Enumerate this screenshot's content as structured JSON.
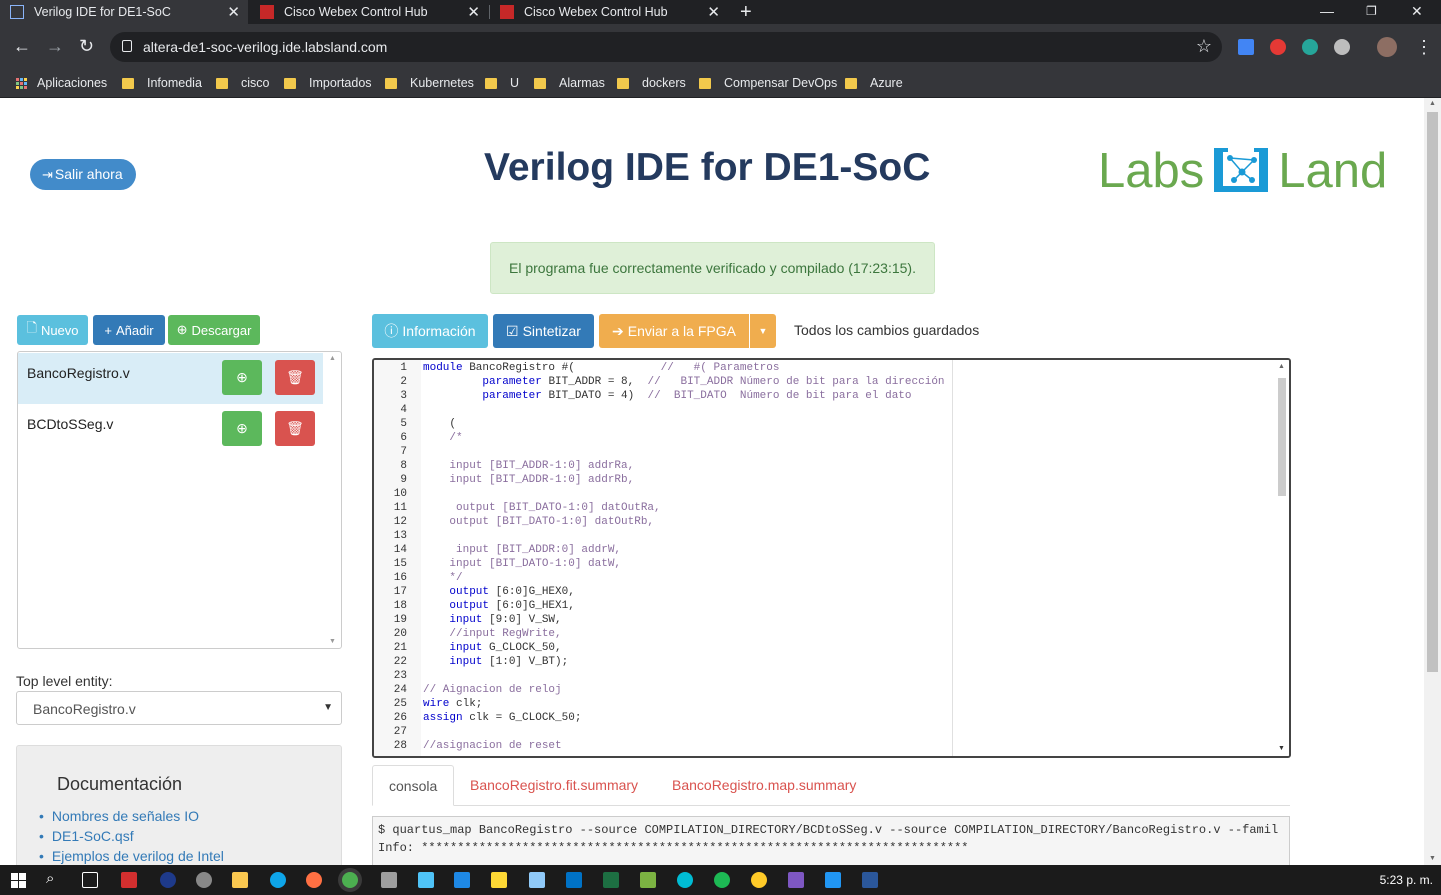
{
  "browser": {
    "tabs": [
      {
        "title": "Verilog IDE for DE1-SoC",
        "active": true
      },
      {
        "title": "Cisco Webex Control Hub",
        "active": false
      },
      {
        "title": "Cisco Webex Control Hub",
        "active": false
      }
    ],
    "url": "altera-de1-soc-verilog.ide.labsland.com",
    "bookmarks": [
      "Aplicaciones",
      "Infomedia",
      "cisco",
      "Importados",
      "Kubernetes",
      "U",
      "Alarmas",
      "dockers",
      "Compensar DevOps",
      "Azure"
    ]
  },
  "header": {
    "exit_label": "Salir ahora",
    "title": "Verilog IDE for DE1-SoC",
    "logo_left": "Labs",
    "logo_right": "Land"
  },
  "alert": "El programa fue correctamente verificado y compilado (17:23:15).",
  "file_toolbar": {
    "new": "Nuevo",
    "add": "Añadir",
    "download": "Descargar"
  },
  "files": [
    {
      "name": "BancoRegistro.v",
      "selected": true
    },
    {
      "name": "BCDtoSSeg.v",
      "selected": false
    }
  ],
  "top_level": {
    "label": "Top level entity:",
    "value": "BancoRegistro.v"
  },
  "docs": {
    "title": "Documentación",
    "links": [
      "Nombres de señales IO",
      "DE1-SoC.qsf",
      "Ejemplos de verilog de Intel"
    ]
  },
  "editor_toolbar": {
    "info": "Información",
    "synth": "Sintetizar",
    "send": "Enviar a la FPGA",
    "status": "Todos los cambios guardados"
  },
  "code": [
    [
      {
        "t": "module",
        "c": "kw"
      },
      {
        "t": " BancoRegistro #(             ",
        "c": ""
      },
      {
        "t": "//   #( Parametros",
        "c": "cm"
      }
    ],
    [
      {
        "t": "         ",
        "c": ""
      },
      {
        "t": "parameter",
        "c": "kw"
      },
      {
        "t": " BIT_ADDR = 8,  ",
        "c": ""
      },
      {
        "t": "//   BIT_ADDR Número de bit para la dirección",
        "c": "cm"
      }
    ],
    [
      {
        "t": "         ",
        "c": ""
      },
      {
        "t": "parameter",
        "c": "kw"
      },
      {
        "t": " BIT_DATO = 4)  ",
        "c": ""
      },
      {
        "t": "//  BIT_DATO  Número de bit para el dato",
        "c": "cm"
      }
    ],
    [],
    [
      {
        "t": "    (",
        "c": ""
      }
    ],
    [
      {
        "t": "    /*",
        "c": "cm"
      }
    ],
    [],
    [
      {
        "t": "    input [BIT_ADDR-1:0] addrRa,",
        "c": "cm"
      }
    ],
    [
      {
        "t": "    input [BIT_ADDR-1:0] addrRb,",
        "c": "cm"
      }
    ],
    [],
    [
      {
        "t": "     output [BIT_DATO-1:0] datOutRa,",
        "c": "cm"
      }
    ],
    [
      {
        "t": "    output [BIT_DATO-1:0] datOutRb,",
        "c": "cm"
      }
    ],
    [],
    [
      {
        "t": "     input [BIT_ADDR:0] addrW,",
        "c": "cm"
      }
    ],
    [
      {
        "t": "    input [BIT_DATO-1:0] datW,",
        "c": "cm"
      }
    ],
    [
      {
        "t": "    */",
        "c": "cm"
      }
    ],
    [
      {
        "t": "    ",
        "c": ""
      },
      {
        "t": "output",
        "c": "kw"
      },
      {
        "t": " [6:0]G_HEX0,",
        "c": ""
      }
    ],
    [
      {
        "t": "    ",
        "c": ""
      },
      {
        "t": "output",
        "c": "kw"
      },
      {
        "t": " [6:0]G_HEX1,",
        "c": ""
      }
    ],
    [
      {
        "t": "    ",
        "c": ""
      },
      {
        "t": "input",
        "c": "kw"
      },
      {
        "t": " [9:0] V_SW,",
        "c": ""
      }
    ],
    [
      {
        "t": "    //input RegWrite,",
        "c": "cm"
      }
    ],
    [
      {
        "t": "    ",
        "c": ""
      },
      {
        "t": "input",
        "c": "kw"
      },
      {
        "t": " G_CLOCK_50,",
        "c": ""
      }
    ],
    [
      {
        "t": "    ",
        "c": ""
      },
      {
        "t": "input",
        "c": "kw"
      },
      {
        "t": " [1:0] V_BT);",
        "c": ""
      }
    ],
    [],
    [
      {
        "t": "// Aignacion de reloj",
        "c": "cm"
      }
    ],
    [
      {
        "t": "wire",
        "c": "kw"
      },
      {
        "t": " clk;",
        "c": ""
      }
    ],
    [
      {
        "t": "assign",
        "c": "kw"
      },
      {
        "t": " clk = G_CLOCK_50;",
        "c": ""
      }
    ],
    [],
    [
      {
        "t": "//asignacion de reset",
        "c": "cm"
      }
    ]
  ],
  "bottom_tabs": [
    "consola",
    "BancoRegistro.fit.summary",
    "BancoRegistro.map.summary"
  ],
  "console_lines": [
    "$ quartus_map BancoRegistro --source COMPILATION_DIRECTORY/BCDtoSSeg.v --source COMPILATION_DIRECTORY/BancoRegistro.v --famil",
    "Info: ****************************************************************************"
  ],
  "taskbar": {
    "time": "5:23 p. m."
  }
}
